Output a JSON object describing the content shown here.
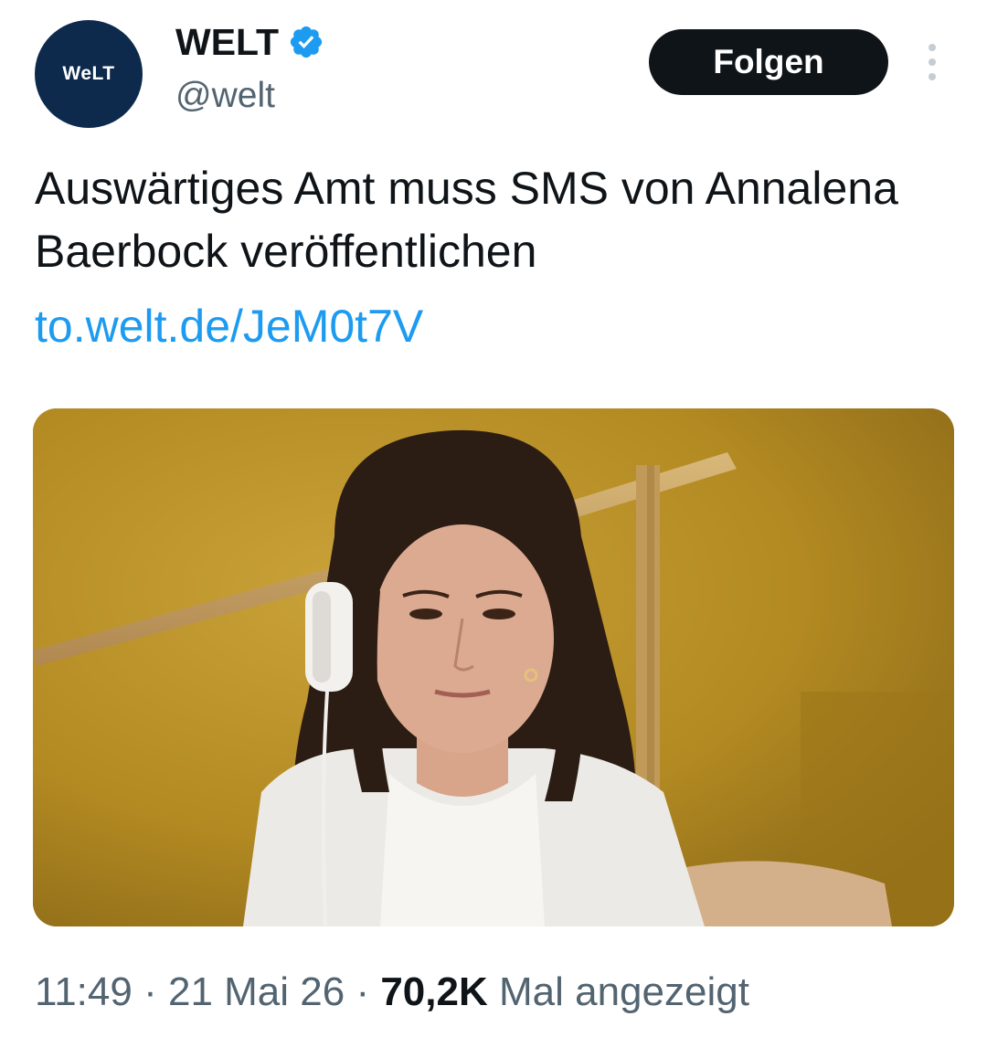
{
  "account": {
    "avatar_text": "WeLT",
    "display_name": "WELT",
    "handle": "@welt",
    "verified_icon": "verified-badge-icon",
    "avatar_color": "#0d2a4d",
    "verified_color": "#1d9bf0"
  },
  "actions": {
    "follow_label": "Folgen",
    "more_icon": "more-vertical-icon"
  },
  "tweet": {
    "text": "Auswärtiges Amt muss SMS von Annalena Baerbock veröffentlichen",
    "link": "to.welt.de/JeM0t7V",
    "link_color": "#1d9bf0"
  },
  "media": {
    "kind": "photo",
    "background_color": "#b88d22"
  },
  "meta": {
    "time": "11:49",
    "separator": "·",
    "date": "21 Mai 26",
    "views_count": "70,2K",
    "views_label": "Mal angezeigt"
  }
}
